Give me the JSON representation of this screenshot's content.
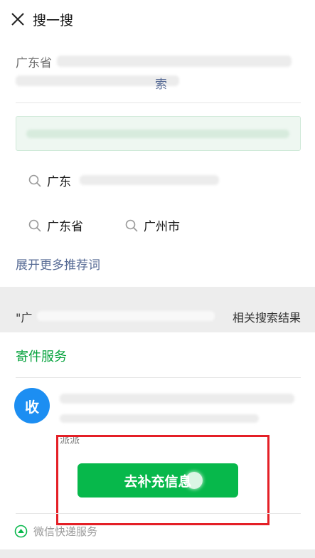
{
  "header": {
    "title": "搜一搜"
  },
  "query": {
    "line1_prefix": "广东省",
    "line2_fragment": "索"
  },
  "suggestions": {
    "item1_prefix": "广东",
    "chip1": "广东省",
    "chip2": "广州市",
    "expand_label": "展开更多推荐词"
  },
  "related": {
    "left_mark": "\"广",
    "right_suffix": "相关搜索结果"
  },
  "service": {
    "section_title": "寄件服务",
    "avatar_text": "收",
    "desc_text": "派派",
    "primary_button": "去补充信息"
  },
  "footer": {
    "text": "微信快递服务"
  },
  "colors": {
    "accent_green": "#07a33e",
    "button_green": "#07b84b",
    "link_blue": "#576b95",
    "avatar_blue": "#1c8ef2",
    "highlight_red": "#e41f26"
  }
}
